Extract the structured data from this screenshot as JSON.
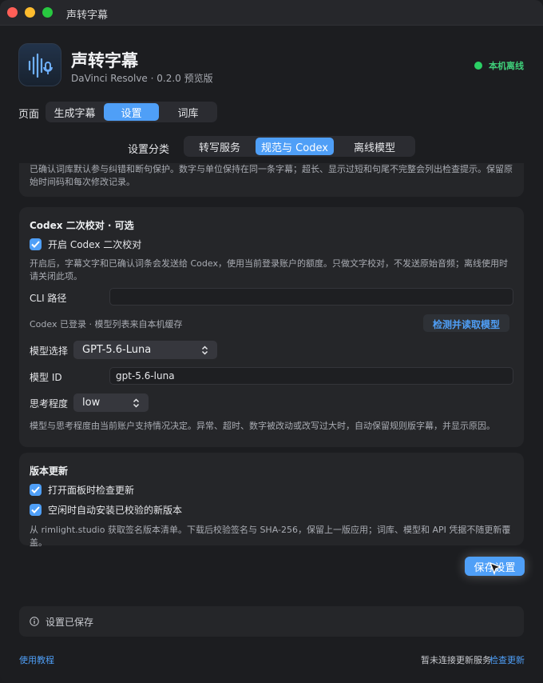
{
  "window": {
    "title": "声转字幕"
  },
  "header": {
    "app_name": "声转字幕",
    "subtitle": "DaVinci Resolve · 0.2.0 预览版",
    "status_text": "本机离线",
    "status_color": "#2bd065",
    "icon": "waveform-mic-icon"
  },
  "page_nav": {
    "label": "页面",
    "tabs": [
      "生成字幕",
      "设置",
      "词库"
    ],
    "active": "设置"
  },
  "category_nav": {
    "label": "设置分类",
    "tabs": [
      "转写服务",
      "规范与 Codex",
      "离线模型"
    ],
    "active": "规范与 Codex"
  },
  "normalization_card": {
    "text_partial": "已确认词库默认参与纠错和断句保护。数字与单位保持在同一条字幕；超长、显示过短和句尾不完整会列出检查提示。保留原始时间码和每次修改记录。"
  },
  "codex_card": {
    "title": "Codex 二次校对 · 可选",
    "enable_label": "开启 Codex 二次校对",
    "enable_checked": true,
    "enable_desc": "开启后，字幕文字和已确认词条会发送给 Codex，使用当前登录账户的额度。只做文字校对，不发送原始音频；离线使用时请关闭此项。",
    "cli_label": "CLI 路径",
    "cli_value": "",
    "login_status": "Codex 已登录 · 模型列表来自本机缓存",
    "detect_button": "检测并读取模型",
    "model_select_label": "模型选择",
    "model_select_value": "GPT-5.6-Luna",
    "model_id_label": "模型 ID",
    "model_id_value": "gpt-5.6-luna",
    "effort_label": "思考程度",
    "effort_value": "low",
    "footer_desc": "模型与思考程度由当前账户支持情况决定。异常、超时、数字被改动或改写过大时，自动保留规则版字幕，并显示原因。"
  },
  "update_card": {
    "title": "版本更新",
    "check_on_open_label": "打开面板时检查更新",
    "check_on_open_checked": true,
    "auto_install_label": "空闲时自动安装已校验的新版本",
    "auto_install_checked": true,
    "desc": "从 rimlight.studio 获取签名版本清单。下载后校验签名与 SHA-256，保留上一版应用；词库、模型和 API 凭据不随更新覆盖。"
  },
  "save_button": "保存设置",
  "notice": {
    "icon": "info-icon",
    "text": "设置已保存"
  },
  "footer": {
    "tutorial_link": "使用教程",
    "update_status": "暂未连接更新服务",
    "check_update_link": "检查更新"
  },
  "colors": {
    "accent": "#4f9ff7",
    "background": "#1c1d20",
    "card": "#252629"
  }
}
